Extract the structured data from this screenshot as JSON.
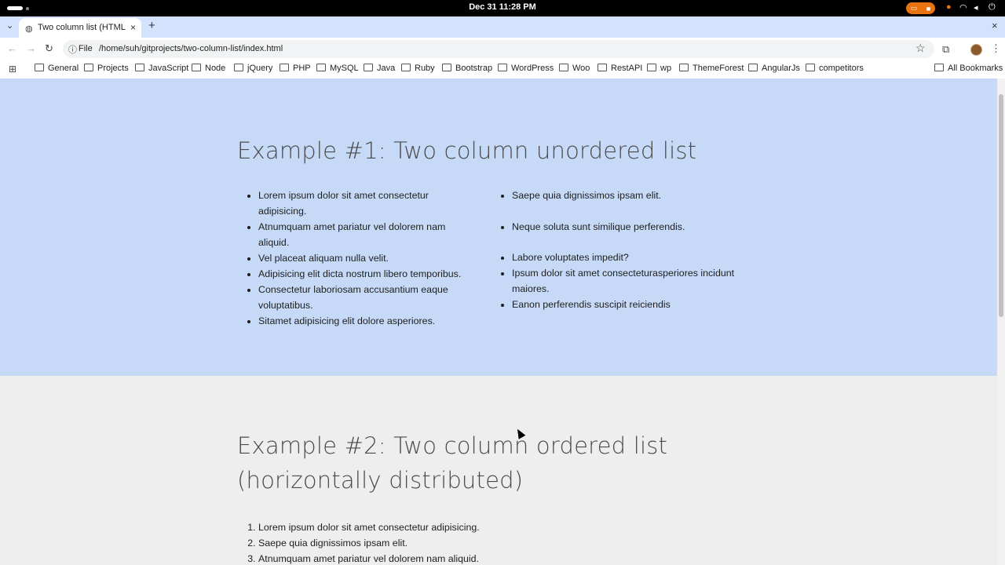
{
  "os": {
    "clock": "Dec 31  11:28 PM"
  },
  "tab": {
    "title": "Two column list (HTML C"
  },
  "toolbar": {
    "scheme": "File",
    "url": "/home/suh/gitprojects/two-column-list/index.html"
  },
  "bookmarks": {
    "items": [
      "General",
      "Projects",
      "JavaScript",
      "Node",
      "jQuery",
      "PHP",
      "MySQL",
      "Java",
      "Ruby",
      "Bootstrap",
      "WordPress",
      "Woo",
      "RestAPI",
      "wp",
      "ThemeForest",
      "AngularJs",
      "competitors"
    ],
    "all": "All Bookmarks"
  },
  "example1": {
    "heading": "Example #1: Two column unordered list",
    "left": [
      "Lorem ipsum dolor sit amet consectetur adipisicing.",
      "Atnumquam amet pariatur vel dolorem nam aliquid.",
      "Vel placeat aliquam nulla velit.",
      "Adipisicing elit dicta nostrum libero temporibus.",
      "Consectetur laboriosam accusantium eaque voluptatibus.",
      "Sitamet adipisicing elit dolore asperiores."
    ],
    "right": [
      "Saepe quia dignissimos ipsam elit.",
      "Neque soluta sunt similique perferendis.",
      "Labore voluptates impedit?",
      "Ipsum dolor sit amet consecteturasperiores incidunt maiores.",
      "Eanon perferendis suscipit reiciendis"
    ]
  },
  "example2": {
    "heading_line1": "Example #2: Two column ordered list",
    "heading_line2": "(horizontally distributed)",
    "items": [
      "Lorem ipsum dolor sit amet consectetur adipisicing.",
      "Saepe quia dignissimos ipsam elit.",
      "Atnumquam amet pariatur vel dolorem nam aliquid."
    ]
  }
}
